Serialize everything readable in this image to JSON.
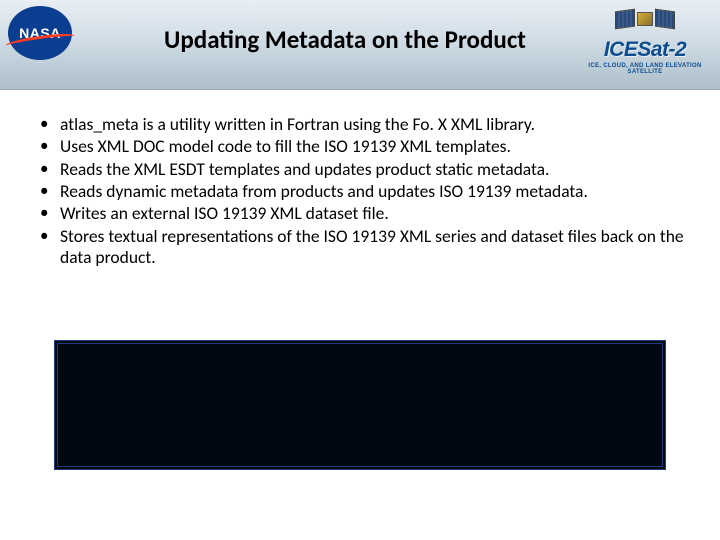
{
  "header": {
    "nasa_logo_text": "NASA",
    "title": "Updating Metadata on the Product",
    "icesat": {
      "name": "ICESat",
      "suffix": "-2",
      "sub": "ICE, CLOUD, AND LAND ELEVATION SATELLITE"
    }
  },
  "bullets": [
    "atlas_meta is a utility written in Fortran using the Fo. X XML library.",
    "Uses XML DOC model code to fill the ISO 19139 XML templates.",
    "Reads the XML ESDT templates and updates product static metadata.",
    "Reads dynamic metadata from products and updates ISO 19139 metadata.",
    "Writes an external ISO 19139 XML dataset file.",
    "Stores textual representations of the ISO 19139 XML series and dataset files back on the data product."
  ]
}
